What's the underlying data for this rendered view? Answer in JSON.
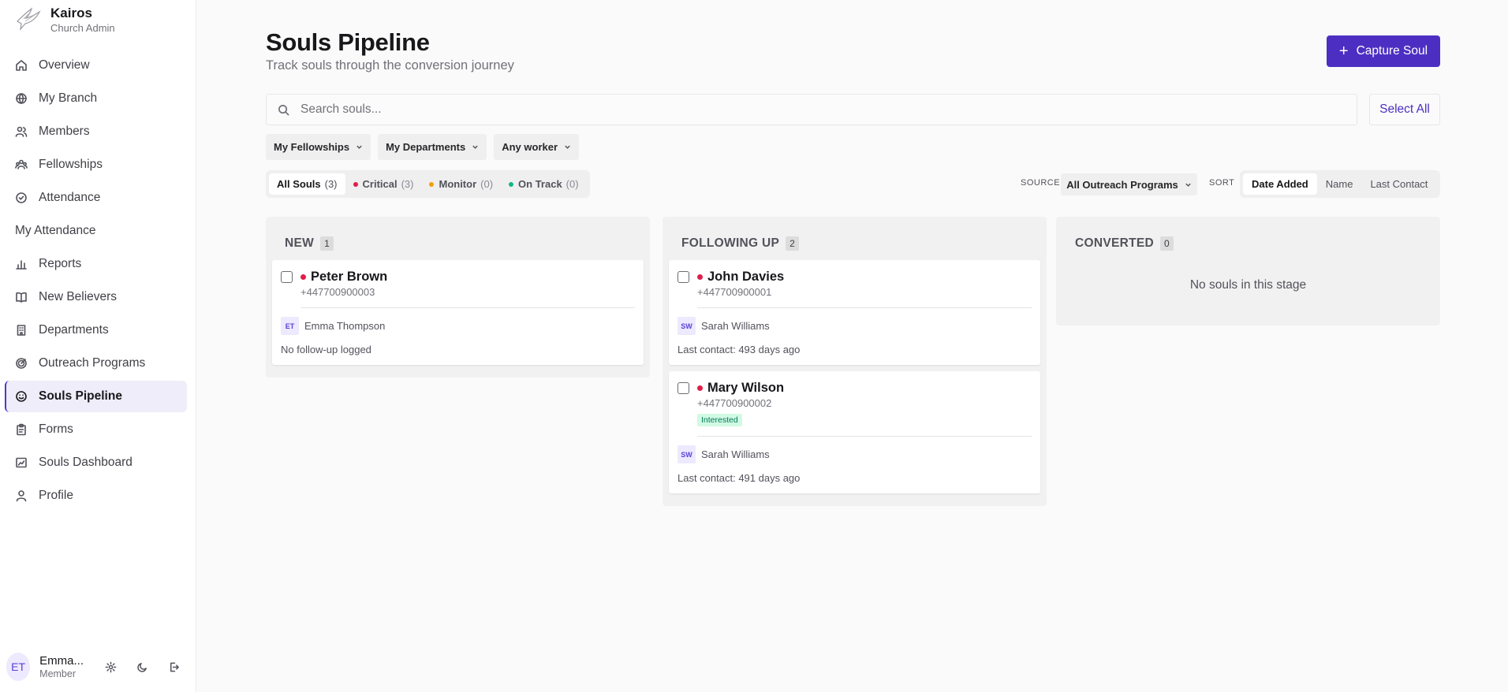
{
  "brand": {
    "name": "Kairos",
    "subtitle": "Church Admin"
  },
  "nav": [
    {
      "label": "Overview",
      "icon": "home-icon"
    },
    {
      "label": "My Branch",
      "icon": "globe-icon"
    },
    {
      "label": "Members",
      "icon": "users-icon"
    },
    {
      "label": "Fellowships",
      "icon": "layers-icon"
    },
    {
      "label": "Attendance",
      "icon": "check-circle-icon"
    },
    {
      "label": "My Attendance",
      "icon": ""
    },
    {
      "label": "Reports",
      "icon": "bar-chart-icon"
    },
    {
      "label": "New Believers",
      "icon": "book-icon"
    },
    {
      "label": "Departments",
      "icon": "building-icon"
    },
    {
      "label": "Outreach Programs",
      "icon": "target-icon"
    },
    {
      "label": "Souls Pipeline",
      "icon": "smile-icon",
      "active": true
    },
    {
      "label": "Forms",
      "icon": "clipboard-icon"
    },
    {
      "label": "Souls Dashboard",
      "icon": "dashboard-icon"
    },
    {
      "label": "Profile",
      "icon": "user-icon"
    }
  ],
  "user": {
    "initials": "ET",
    "name": "Emma...",
    "role": "Member"
  },
  "header": {
    "title": "Souls Pipeline",
    "subtitle": "Track souls through the conversion journey",
    "capture_label": "Capture Soul",
    "capture_icon": "+"
  },
  "search": {
    "placeholder": "Search souls...",
    "value": "",
    "select_all": "Select All"
  },
  "filters": [
    "My Fellowships",
    "My Departments",
    "Any worker"
  ],
  "status_tabs": [
    {
      "label": "All Souls",
      "count": "(3)",
      "dot": ""
    },
    {
      "label": "Critical",
      "count": "(3)",
      "dot": "#e11d48"
    },
    {
      "label": "Monitor",
      "count": "(0)",
      "dot": "#f59e0b"
    },
    {
      "label": "On Track",
      "count": "(0)",
      "dot": "#10b981"
    }
  ],
  "source": {
    "label": "SOURCE",
    "value": "All Outreach Programs"
  },
  "sort": {
    "label": "SORT",
    "options": [
      "Date Added",
      "Name",
      "Last Contact"
    ],
    "active": "Date Added"
  },
  "columns": [
    {
      "title": "NEW",
      "count": "1",
      "cards": [
        {
          "name": "Peter Brown",
          "phone": "+447700900003",
          "badge": "",
          "worker_initials": "ET",
          "worker": "Emma Thompson",
          "last": "No follow-up logged"
        }
      ],
      "empty": ""
    },
    {
      "title": "FOLLOWING UP",
      "count": "2",
      "cards": [
        {
          "name": "John Davies",
          "phone": "+447700900001",
          "badge": "",
          "worker_initials": "SW",
          "worker": "Sarah Williams",
          "last": "Last contact: 493 days ago"
        },
        {
          "name": "Mary Wilson",
          "phone": "+447700900002",
          "badge": "Interested",
          "worker_initials": "SW",
          "worker": "Sarah Williams",
          "last": "Last contact: 491 days ago"
        }
      ],
      "empty": ""
    },
    {
      "title": "CONVERTED",
      "count": "0",
      "cards": [],
      "empty": "No souls in this stage"
    }
  ],
  "colors": {
    "accent": "#4c2fc2",
    "critical": "#e11d48",
    "monitor": "#f59e0b",
    "on_track": "#10b981"
  }
}
